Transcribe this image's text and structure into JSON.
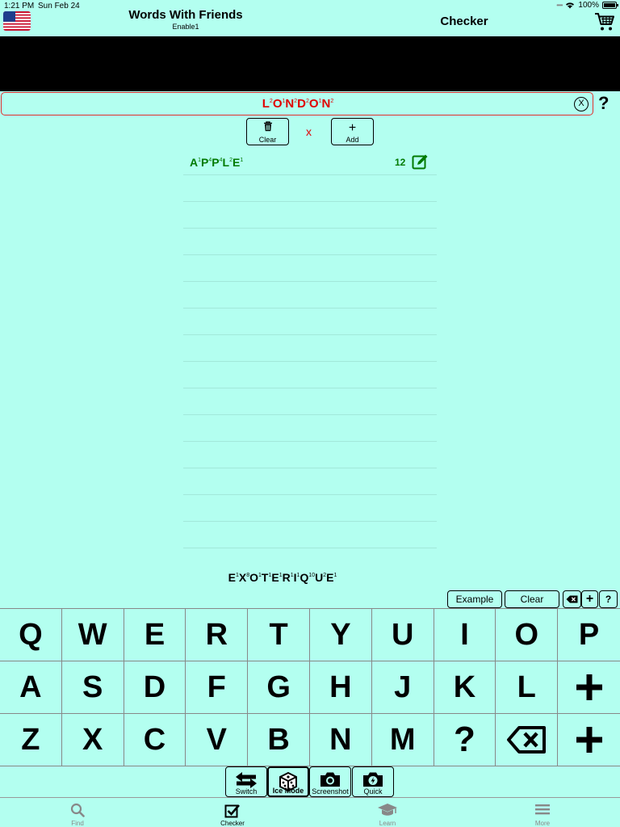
{
  "status": {
    "time": "1:21 PM",
    "date": "Sun Feb 24",
    "battery": "100%",
    "battery_level": 1.0
  },
  "header": {
    "app_title": "Words With Friends",
    "dictionary": "Enable1",
    "page_title": "Checker"
  },
  "word_input": {
    "letters": [
      [
        "L",
        "2"
      ],
      [
        "O",
        "1"
      ],
      [
        "N",
        "2"
      ],
      [
        "D",
        "2"
      ],
      [
        "O",
        "1"
      ],
      [
        "N",
        "2"
      ]
    ],
    "clear_glyph": "X",
    "help_glyph": "?"
  },
  "list_controls": {
    "clear_label": "Clear",
    "add_label": "Add",
    "add_glyph": "+",
    "separator": "x"
  },
  "word_list": {
    "rows": [
      {
        "letters": [
          [
            "A",
            "1"
          ],
          [
            "P",
            "4"
          ],
          [
            "P",
            "4"
          ],
          [
            "L",
            "2"
          ],
          [
            "E",
            "1"
          ]
        ],
        "score": "12"
      }
    ],
    "empty_rows": 14
  },
  "tile_preview": {
    "letters": [
      [
        "E",
        "1"
      ],
      [
        "X",
        "8"
      ],
      [
        "O",
        "1"
      ],
      [
        "T",
        "1"
      ],
      [
        "E",
        "1"
      ],
      [
        "R",
        "1"
      ],
      [
        "I",
        "1"
      ],
      [
        "Q",
        "10"
      ],
      [
        "U",
        "2"
      ],
      [
        "E",
        "1"
      ]
    ]
  },
  "keyboard_tools": {
    "example_label": "Example",
    "clear_label": "Clear",
    "plus_glyph": "+",
    "help_glyph": "?"
  },
  "keyboard": {
    "rows": [
      [
        "Q",
        "W",
        "E",
        "R",
        "T",
        "Y",
        "U",
        "I",
        "O",
        "P"
      ],
      [
        "A",
        "S",
        "D",
        "F",
        "G",
        "H",
        "J",
        "K",
        "L",
        "+"
      ],
      [
        "Z",
        "X",
        "C",
        "V",
        "B",
        "N",
        "M",
        "?",
        "backspace",
        "+"
      ]
    ]
  },
  "mode_bar": [
    {
      "label": "Switch",
      "icon": "switch-arrows-icon"
    },
    {
      "label": "Ice Mode",
      "icon": "dice-icon",
      "active": true
    },
    {
      "label": "Screenshot",
      "icon": "camera-icon"
    },
    {
      "label": "Quick",
      "icon": "quick-camera-icon"
    }
  ],
  "tabs": [
    {
      "label": "Find",
      "icon": "search-icon"
    },
    {
      "label": "Checker",
      "icon": "checkbox-icon",
      "active": true
    },
    {
      "label": "Learn",
      "icon": "graduation-cap-icon"
    },
    {
      "label": "More",
      "icon": "menu-icon"
    }
  ]
}
